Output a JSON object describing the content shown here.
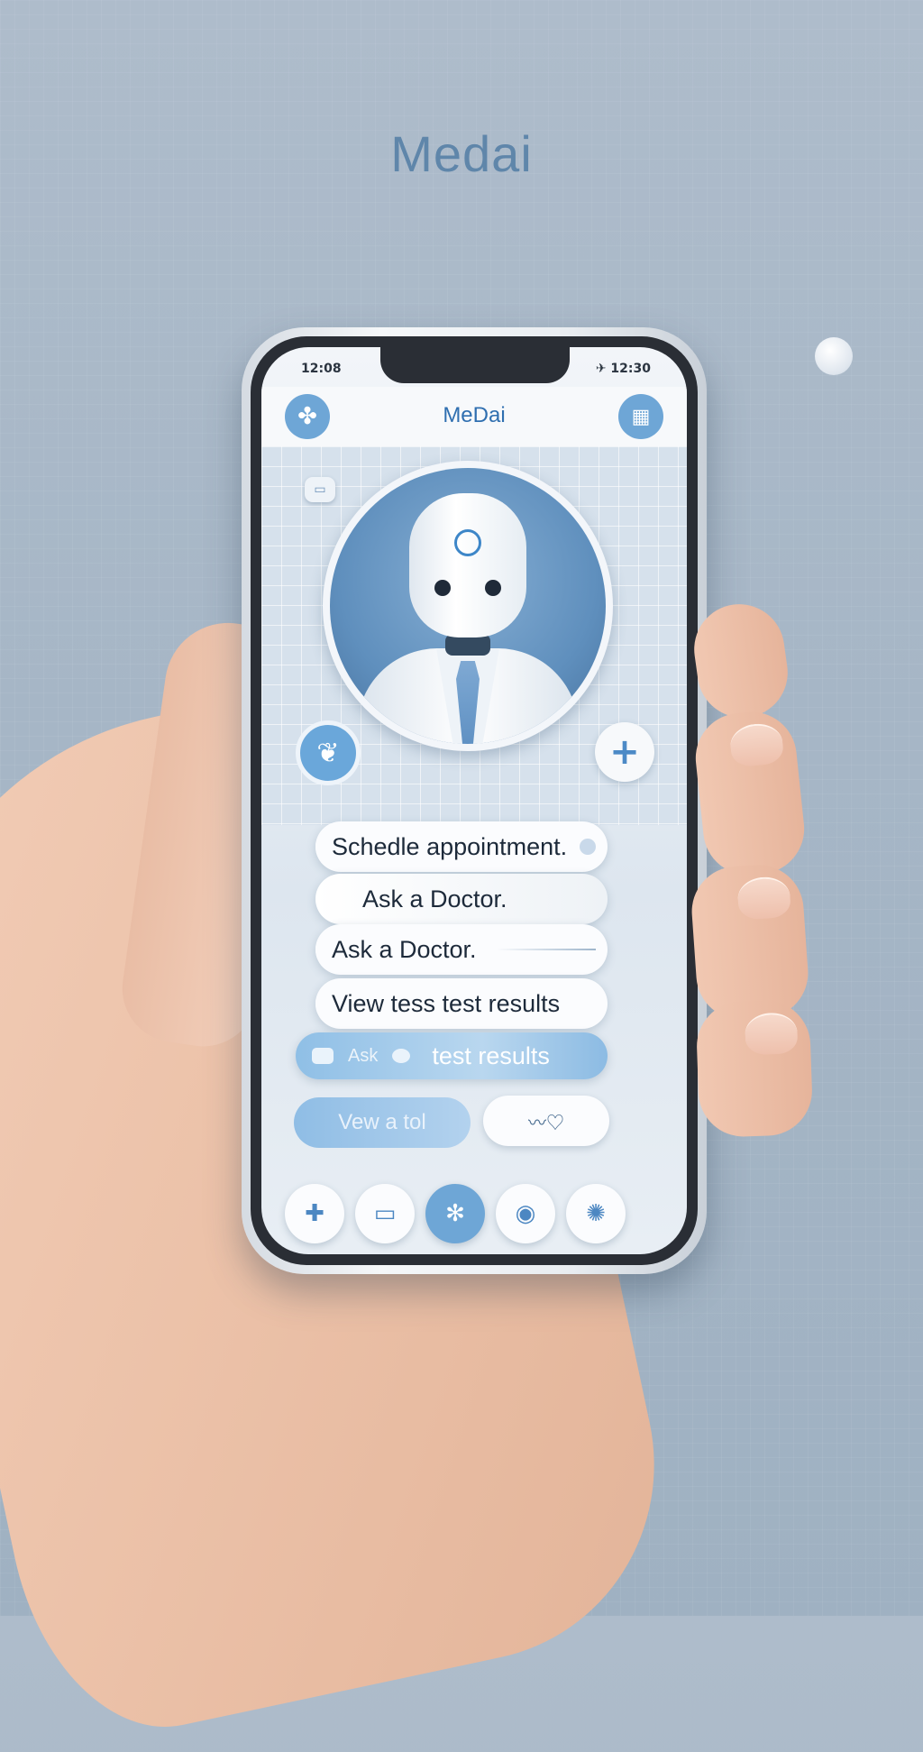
{
  "brand": {
    "title": "Medai"
  },
  "status_bar": {
    "time": "12:08",
    "right": "✈ 12:30"
  },
  "app_bar": {
    "title": "MeDai",
    "left_icon": "clover-icon",
    "right_icon": "grid-icon"
  },
  "assistant": {
    "avatar": "robot-doctor-avatar"
  },
  "hero_actions": {
    "left_icon": "heart-hands-icon",
    "right_icon": "plus-icon"
  },
  "chat": [
    {
      "label": "Schedle appointment.",
      "style": "white",
      "tail": true
    },
    {
      "label": "Ask a Doctor.",
      "style": "white",
      "tail": false
    },
    {
      "label": "Ask a Doctor.",
      "style": "white",
      "tail": true
    },
    {
      "label": "View tess test results",
      "style": "white",
      "tail": true
    },
    {
      "label_left": "Ask",
      "label_right": "test results",
      "style": "blue",
      "tail": false
    }
  ],
  "actions": {
    "left_label": "Vew a tol",
    "right_icon": "heartbeat-icon"
  },
  "bottom_nav": [
    {
      "icon": "plus-icon"
    },
    {
      "icon": "card-icon"
    },
    {
      "icon": "stethoscope-icon"
    },
    {
      "icon": "chat-icon"
    },
    {
      "icon": "settings-icon"
    }
  ],
  "colors": {
    "accent": "#6ea6d6",
    "brand": "#5f86aa",
    "text": "#1d2a3a"
  }
}
